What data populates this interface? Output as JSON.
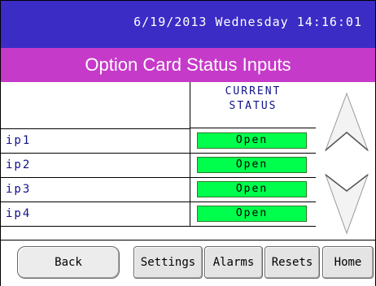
{
  "header": {
    "datetime": "6/19/2013 Wednesday 14:16:01"
  },
  "title": "Option Card Status Inputs",
  "table": {
    "column_header_line1": "CURRENT",
    "column_header_line2": "STATUS",
    "rows": [
      {
        "name": "ip1",
        "status": "Open"
      },
      {
        "name": "ip2",
        "status": "Open"
      },
      {
        "name": "ip3",
        "status": "Open"
      },
      {
        "name": "ip4",
        "status": "Open"
      }
    ]
  },
  "scroll": {
    "up_icon": "chevron-up-icon",
    "down_icon": "chevron-down-icon"
  },
  "footer": {
    "back": "Back",
    "settings": "Settings",
    "alarms": "Alarms",
    "resets": "Resets",
    "home": "Home"
  },
  "colors": {
    "topbar": "#3b2cc6",
    "titlebar": "#c63ac9",
    "status_open": "#00ff4c",
    "label_text": "#11118a"
  }
}
